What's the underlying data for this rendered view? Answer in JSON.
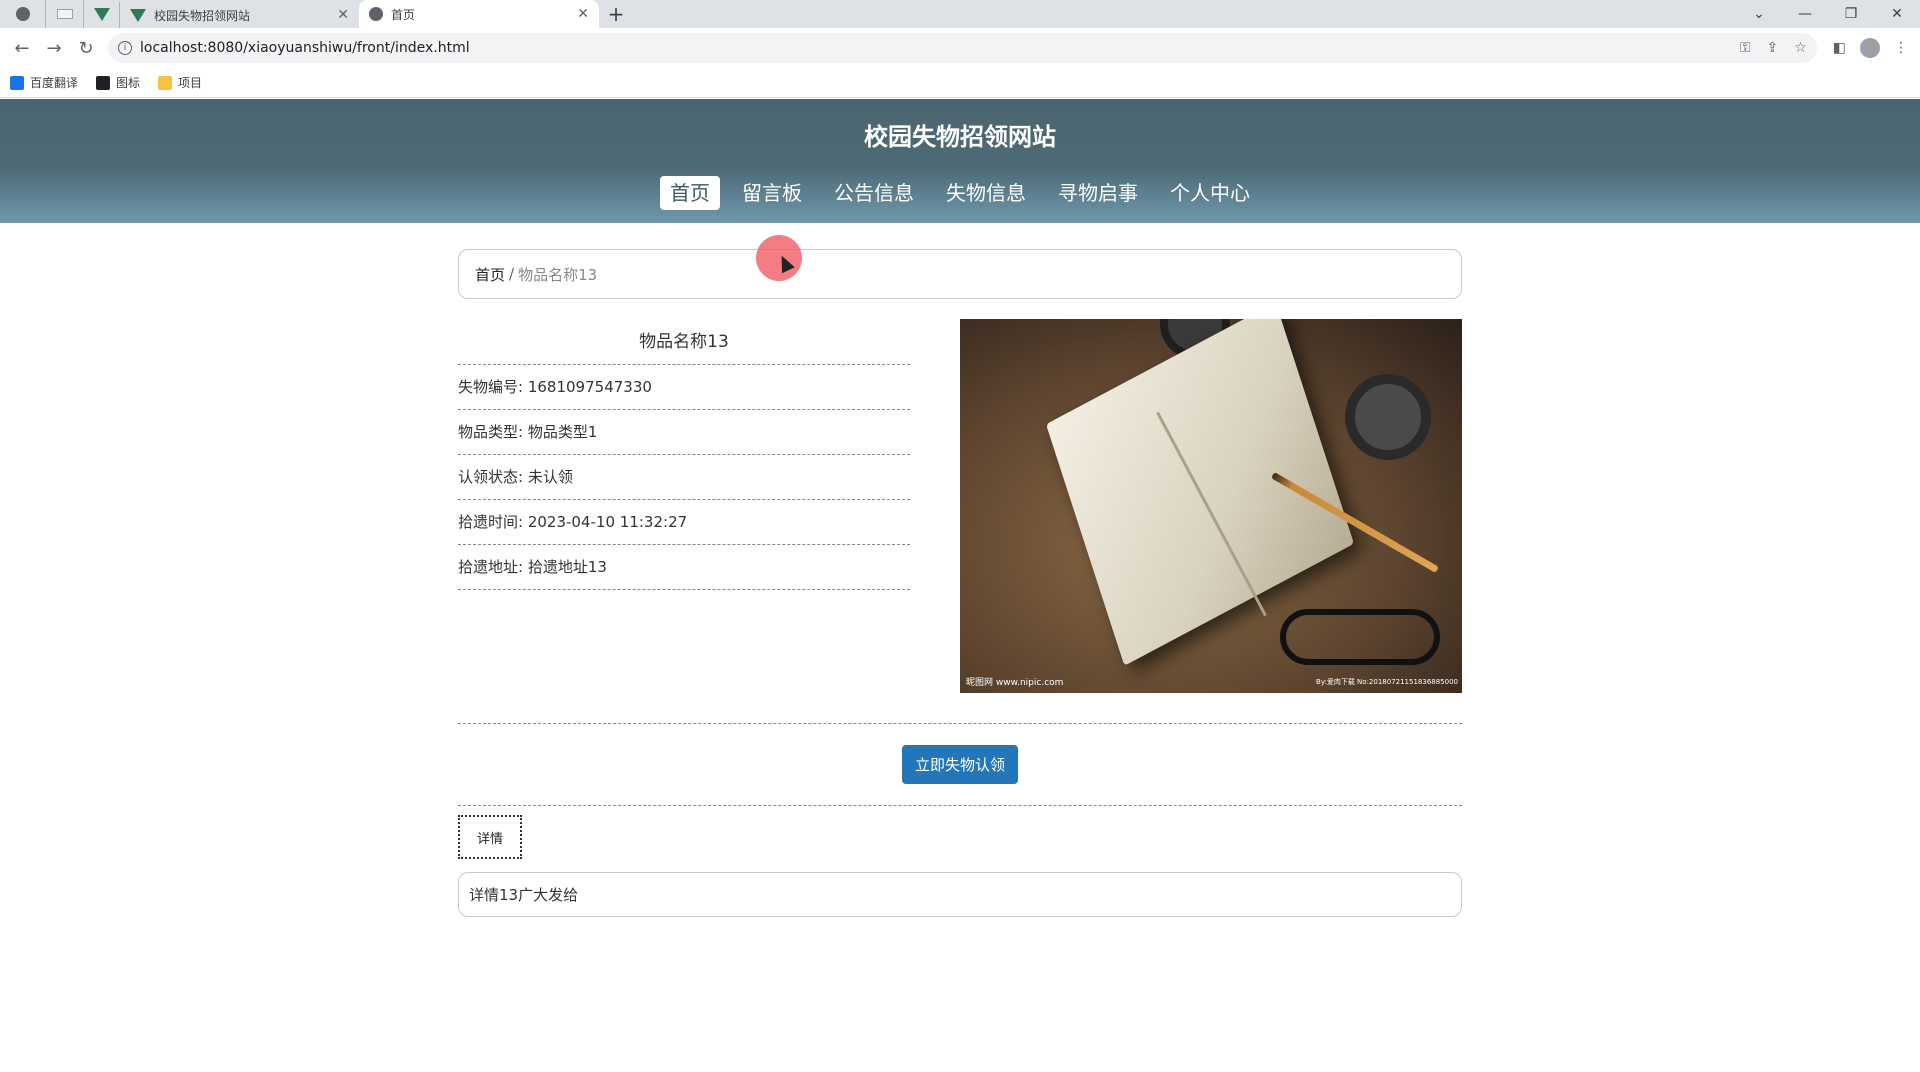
{
  "browser": {
    "tabs": [
      {
        "title": "校园失物招领网站"
      },
      {
        "title": "首页"
      }
    ],
    "url": "localhost:8080/xiaoyuanshiwu/front/index.html",
    "bookmarks": [
      {
        "label": "百度翻译",
        "color": "#1a73e8"
      },
      {
        "label": "图标",
        "color": "#202124"
      },
      {
        "label": "项目",
        "color": "#f4c542"
      }
    ]
  },
  "site": {
    "title": "校园失物招领网站",
    "nav": [
      {
        "label": "首页",
        "active": true
      },
      {
        "label": "留言板"
      },
      {
        "label": "公告信息"
      },
      {
        "label": "失物信息"
      },
      {
        "label": "寻物启事"
      },
      {
        "label": "个人中心"
      }
    ]
  },
  "breadcrumb": {
    "home": "首页",
    "separator": "/",
    "current": "物品名称13"
  },
  "item": {
    "name": "物品名称13",
    "fields": [
      {
        "label": "失物编号:",
        "value": "1681097547330"
      },
      {
        "label": "物品类型:",
        "value": "物品类型1"
      },
      {
        "label": "认领状态:",
        "value": "未认领"
      },
      {
        "label": "拾遗时间:",
        "value": "2023-04-10 11:32:27"
      },
      {
        "label": "拾遗地址:",
        "value": "拾遗地址13"
      }
    ],
    "photo_caption_left": "昵图网 www.nipic.com",
    "photo_caption_right": "By:爱肉下载 No:20180721151836885000"
  },
  "actions": {
    "claim_label": "立即失物认领"
  },
  "detail": {
    "tab_label": "详情",
    "content": "详情13广大发给"
  },
  "colors": {
    "header_top": "#4b6570",
    "header_bottom": "#6f98ab",
    "button": "#2376b7"
  }
}
